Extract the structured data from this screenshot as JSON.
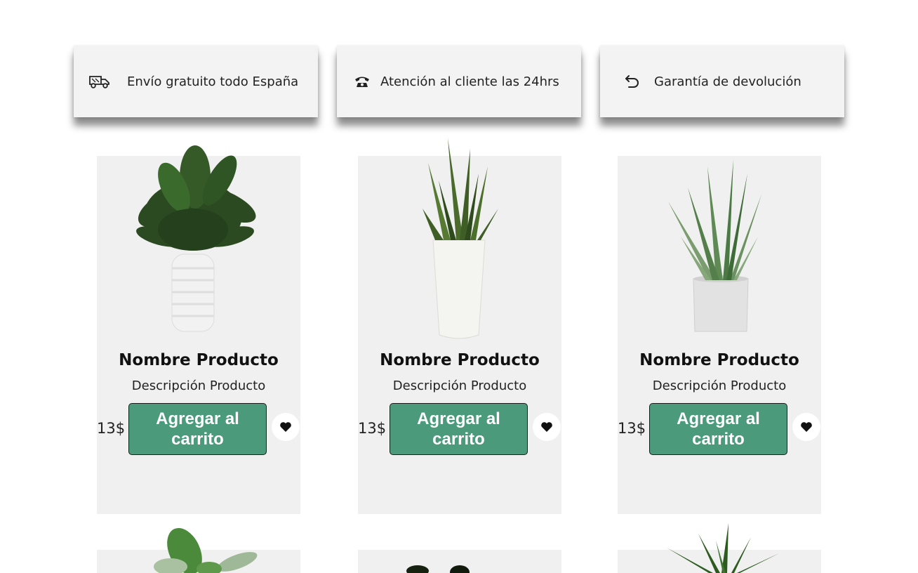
{
  "features": [
    {
      "icon": "truck-icon",
      "text": "Envío gratuito todo España"
    },
    {
      "icon": "phone-icon",
      "text": "Atención al cliente las 24hrs"
    },
    {
      "icon": "return-icon",
      "text": "Garantía de devolución"
    }
  ],
  "products": [
    {
      "name": "Nombre Producto",
      "description": "Descripción Producto",
      "price": "13$",
      "cart_label": "Agregar al carrito",
      "favorite_icon": "heart-icon"
    },
    {
      "name": "Nombre Producto",
      "description": "Descripción Producto",
      "price": "13$",
      "cart_label": "Agregar al carrito",
      "favorite_icon": "heart-icon"
    },
    {
      "name": "Nombre Producto",
      "description": "Descripción Producto",
      "price": "13$",
      "cart_label": "Agregar al carrito",
      "favorite_icon": "heart-icon"
    }
  ],
  "colors": {
    "cart_button": "#4a9a7b",
    "card_background": "#f0f0f0",
    "feature_background": "#f3f3f3"
  }
}
